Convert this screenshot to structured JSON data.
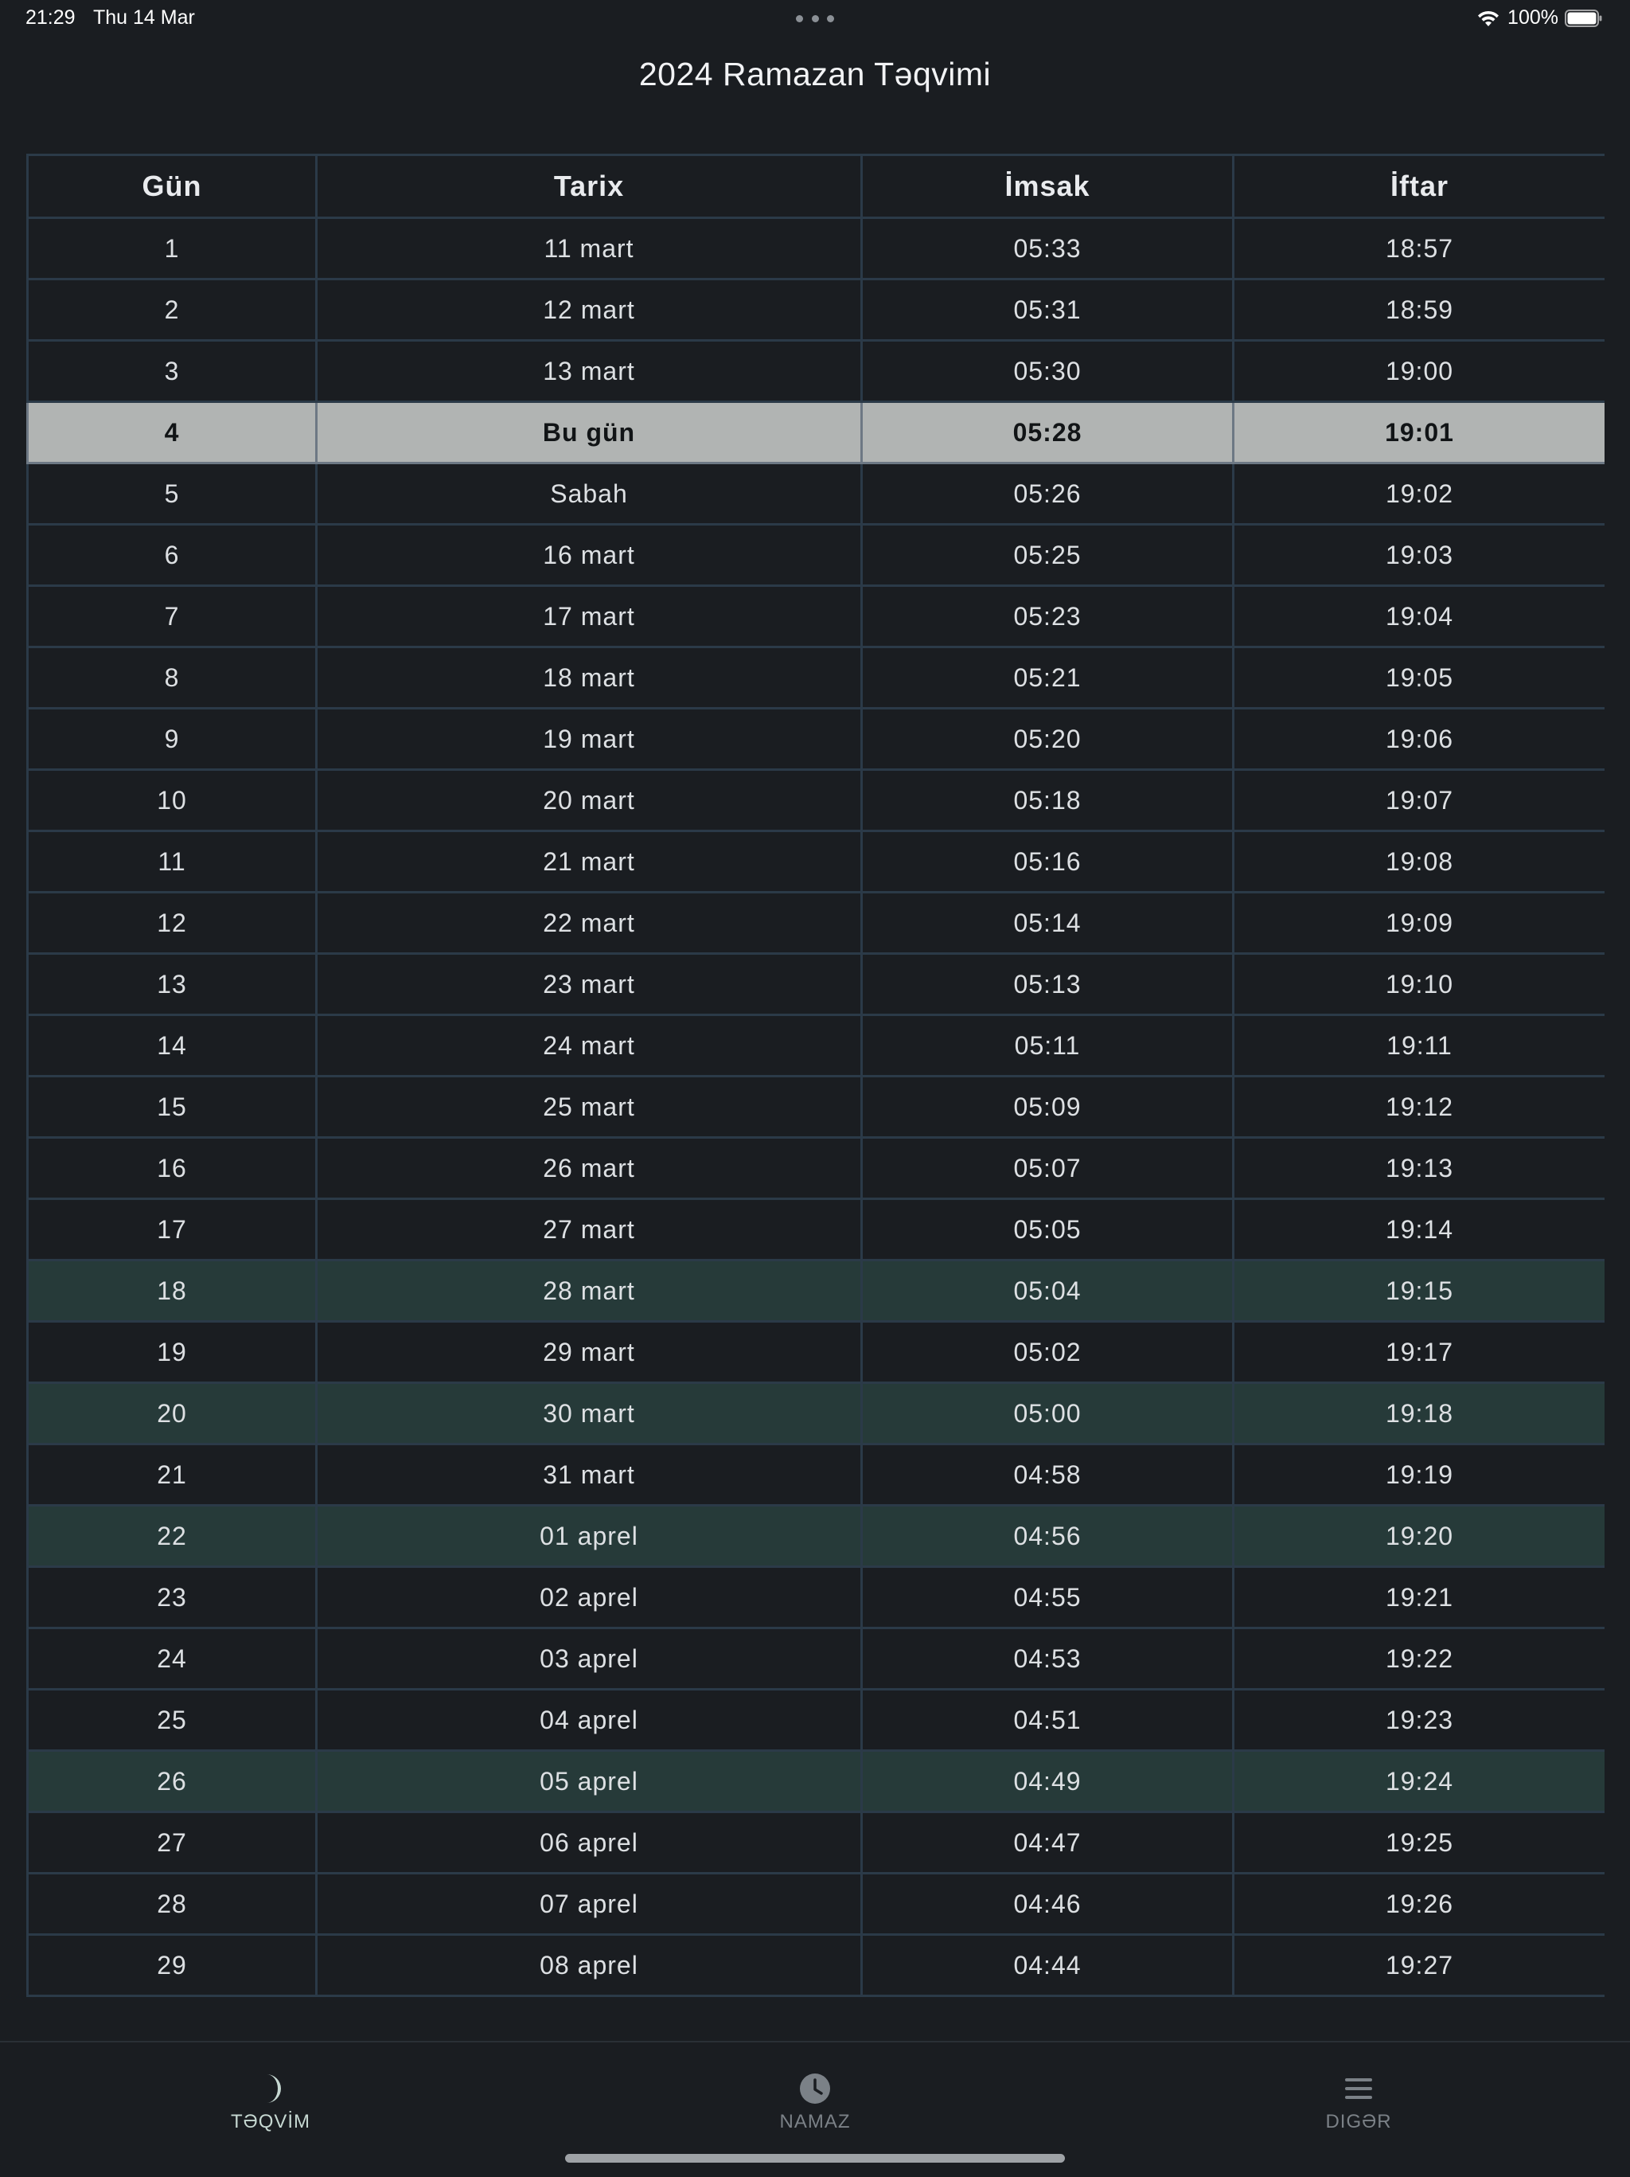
{
  "status_bar": {
    "time": "21:29",
    "date": "Thu 14 Mar",
    "battery": "100%",
    "wifi_icon": "wifi-icon",
    "battery_icon": "battery-full-icon"
  },
  "title": "2024 Ramazan Təqvimi",
  "table": {
    "headers": [
      "Gün",
      "Tarix",
      "İmsak",
      "İftar"
    ],
    "rows": [
      {
        "gun": "1",
        "tarix": "11 mart",
        "imsak": "05:33",
        "iftar": "18:57"
      },
      {
        "gun": "2",
        "tarix": "12 mart",
        "imsak": "05:31",
        "iftar": "18:59"
      },
      {
        "gun": "3",
        "tarix": "13 mart",
        "imsak": "05:30",
        "iftar": "19:00"
      },
      {
        "gun": "4",
        "tarix": "Bu gün",
        "imsak": "05:28",
        "iftar": "19:01"
      },
      {
        "gun": "5",
        "tarix": "Sabah",
        "imsak": "05:26",
        "iftar": "19:02"
      },
      {
        "gun": "6",
        "tarix": "16 mart",
        "imsak": "05:25",
        "iftar": "19:03"
      },
      {
        "gun": "7",
        "tarix": "17 mart",
        "imsak": "05:23",
        "iftar": "19:04"
      },
      {
        "gun": "8",
        "tarix": "18 mart",
        "imsak": "05:21",
        "iftar": "19:05"
      },
      {
        "gun": "9",
        "tarix": "19 mart",
        "imsak": "05:20",
        "iftar": "19:06"
      },
      {
        "gun": "10",
        "tarix": "20 mart",
        "imsak": "05:18",
        "iftar": "19:07"
      },
      {
        "gun": "11",
        "tarix": "21 mart",
        "imsak": "05:16",
        "iftar": "19:08"
      },
      {
        "gun": "12",
        "tarix": "22 mart",
        "imsak": "05:14",
        "iftar": "19:09"
      },
      {
        "gun": "13",
        "tarix": "23 mart",
        "imsak": "05:13",
        "iftar": "19:10"
      },
      {
        "gun": "14",
        "tarix": "24 mart",
        "imsak": "05:11",
        "iftar": "19:11"
      },
      {
        "gun": "15",
        "tarix": "25 mart",
        "imsak": "05:09",
        "iftar": "19:12"
      },
      {
        "gun": "16",
        "tarix": "26 mart",
        "imsak": "05:07",
        "iftar": "19:13"
      },
      {
        "gun": "17",
        "tarix": "27 mart",
        "imsak": "05:05",
        "iftar": "19:14"
      },
      {
        "gun": "18",
        "tarix": "28 mart",
        "imsak": "05:04",
        "iftar": "19:15"
      },
      {
        "gun": "19",
        "tarix": "29 mart",
        "imsak": "05:02",
        "iftar": "19:17"
      },
      {
        "gun": "20",
        "tarix": "30 mart",
        "imsak": "05:00",
        "iftar": "19:18"
      },
      {
        "gun": "21",
        "tarix": "31 mart",
        "imsak": "04:58",
        "iftar": "19:19"
      },
      {
        "gun": "22",
        "tarix": "01 aprel",
        "imsak": "04:56",
        "iftar": "19:20"
      },
      {
        "gun": "23",
        "tarix": "02 aprel",
        "imsak": "04:55",
        "iftar": "19:21"
      },
      {
        "gun": "24",
        "tarix": "03 aprel",
        "imsak": "04:53",
        "iftar": "19:22"
      },
      {
        "gun": "25",
        "tarix": "04 aprel",
        "imsak": "04:51",
        "iftar": "19:23"
      },
      {
        "gun": "26",
        "tarix": "05 aprel",
        "imsak": "04:49",
        "iftar": "19:24"
      },
      {
        "gun": "27",
        "tarix": "06 aprel",
        "imsak": "04:47",
        "iftar": "19:25"
      },
      {
        "gun": "28",
        "tarix": "07 aprel",
        "imsak": "04:46",
        "iftar": "19:26"
      },
      {
        "gun": "29",
        "tarix": "08 aprel",
        "imsak": "04:44",
        "iftar": "19:27"
      }
    ],
    "today_row_gun": "4",
    "highlighted_row_gun": [
      "18",
      "20",
      "22",
      "26"
    ]
  },
  "colors": {
    "background": "#1a1d21",
    "grid": "#2b3a48",
    "today_row": "#b1b4b3",
    "highlight_row": "#263a39",
    "active_tab": "#c6d8d2",
    "inactive_tab": "#7b8187"
  },
  "tabs": [
    {
      "label": "TƏQVİM",
      "icon": "crescent-moon-icon",
      "active": true
    },
    {
      "label": "NAMAZ",
      "icon": "clock-icon",
      "active": false
    },
    {
      "label": "DIGƏR",
      "icon": "menu-icon",
      "active": false
    }
  ]
}
